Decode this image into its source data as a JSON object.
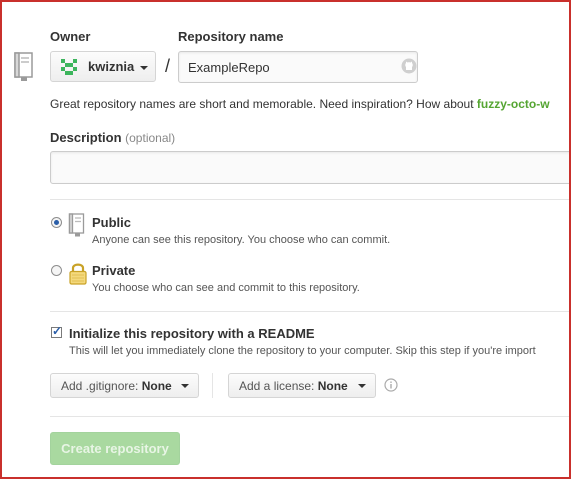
{
  "owner": {
    "label": "Owner",
    "value": "kwiznia"
  },
  "repository": {
    "label": "Repository name",
    "value": "ExampleRepo",
    "separator": "/",
    "hint_prefix": "Great repository names are short and memorable. Need inspiration? How about ",
    "hint_suggestion": "fuzzy-octo-w"
  },
  "description": {
    "label": "Description",
    "optional": "(optional)",
    "value": ""
  },
  "visibility": {
    "selected": "public",
    "public": {
      "title": "Public",
      "note": "Anyone can see this repository. You choose who can commit."
    },
    "private": {
      "title": "Private",
      "note": "You choose who can see and commit to this repository."
    }
  },
  "initialize": {
    "checked": true,
    "title": "Initialize this repository with a README",
    "note": "This will let you immediately clone the repository to your computer. Skip this step if you're import"
  },
  "gitignore": {
    "prefix": "Add .gitignore:",
    "value": "None"
  },
  "license": {
    "prefix": "Add a license:",
    "value": "None"
  },
  "create_button": "Create repository",
  "colors": {
    "frame_border": "#c9302c",
    "suggestion_green": "#55a532",
    "create_button_bg": "#a9d9a0",
    "avatar_green": "#3cb55c"
  },
  "icons": {
    "repo": "repo-book-icon",
    "avatar": "identicon-avatar-icon",
    "validity": "octocat-validity-icon",
    "public": "public-book-icon",
    "private": "padlock-icon",
    "info": "info-icon",
    "caret": "chevron-down-icon"
  }
}
